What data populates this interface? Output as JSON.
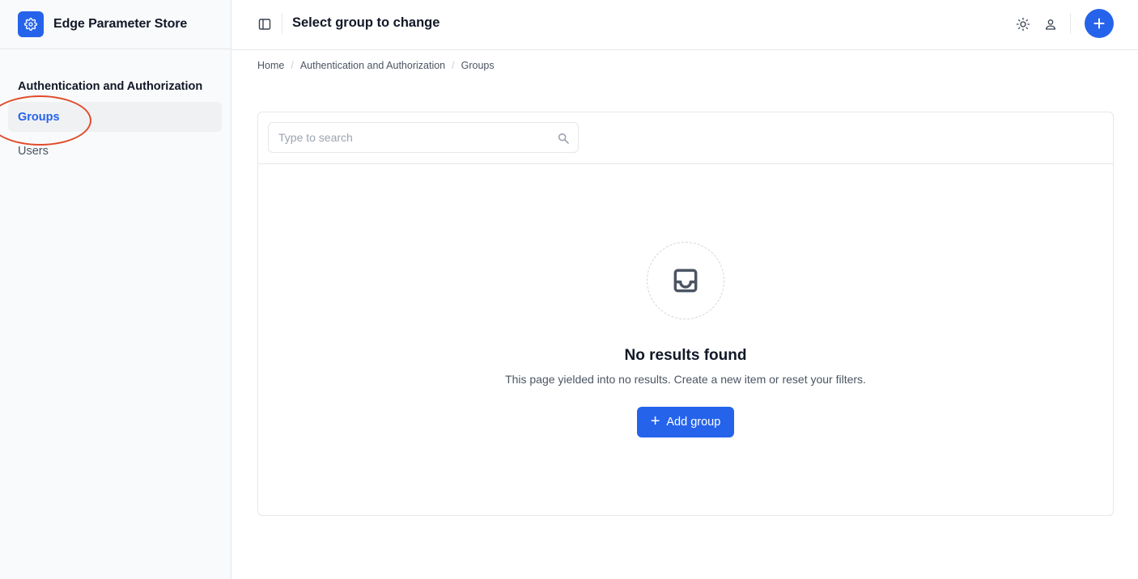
{
  "app": {
    "title": "Edge Parameter Store",
    "logo_icon": "gear-icon"
  },
  "colors": {
    "accent": "#2563eb",
    "annotation": "#e04b2b"
  },
  "sidebar": {
    "section_title": "Authentication and Authorization",
    "items": [
      {
        "label": "Groups",
        "active": true
      },
      {
        "label": "Users",
        "active": false
      }
    ]
  },
  "header": {
    "page_title": "Select group to change"
  },
  "breadcrumb": [
    "Home",
    "Authentication and Authorization",
    "Groups"
  ],
  "search": {
    "placeholder": "Type to search",
    "value": ""
  },
  "empty_state": {
    "icon": "inbox-icon",
    "title": "No results found",
    "description": "This page yielded into no results. Create a new item or reset your filters.",
    "button_label": "Add group"
  }
}
